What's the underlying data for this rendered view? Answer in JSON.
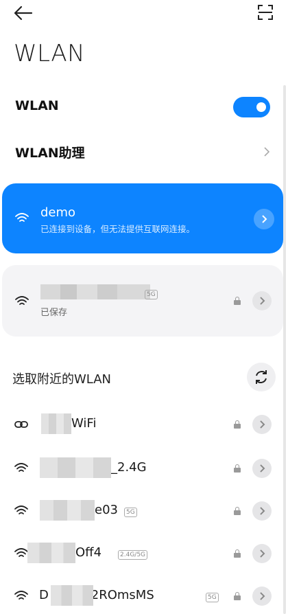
{
  "header": {
    "back_icon": "arrow-left-icon",
    "scan_icon": "scan-icon"
  },
  "page": {
    "title": "WLAN"
  },
  "wlan_toggle": {
    "label": "WLAN",
    "state": "on",
    "color": "#0D84FF"
  },
  "assistant": {
    "label": "WLAN助理"
  },
  "connected": {
    "ssid": "demo",
    "status": "已连接到设备，但无法提供互联网连接。",
    "color": "#0D84FF"
  },
  "saved_network": {
    "status": "已保存",
    "band": "5G"
  },
  "nearby": {
    "title": "选取附近的WLAN",
    "refresh_icon": "refresh-icon",
    "networks": [
      {
        "ssid": "WiFi",
        "band": ""
      },
      {
        "ssid": "_2.4G",
        "band": ""
      },
      {
        "ssid": "e03",
        "band": "5G"
      },
      {
        "ssid": "Off4",
        "band": "2.4G/5G"
      },
      {
        "ssid": "D RKD…2ROmsMS",
        "band": "5G"
      }
    ]
  }
}
